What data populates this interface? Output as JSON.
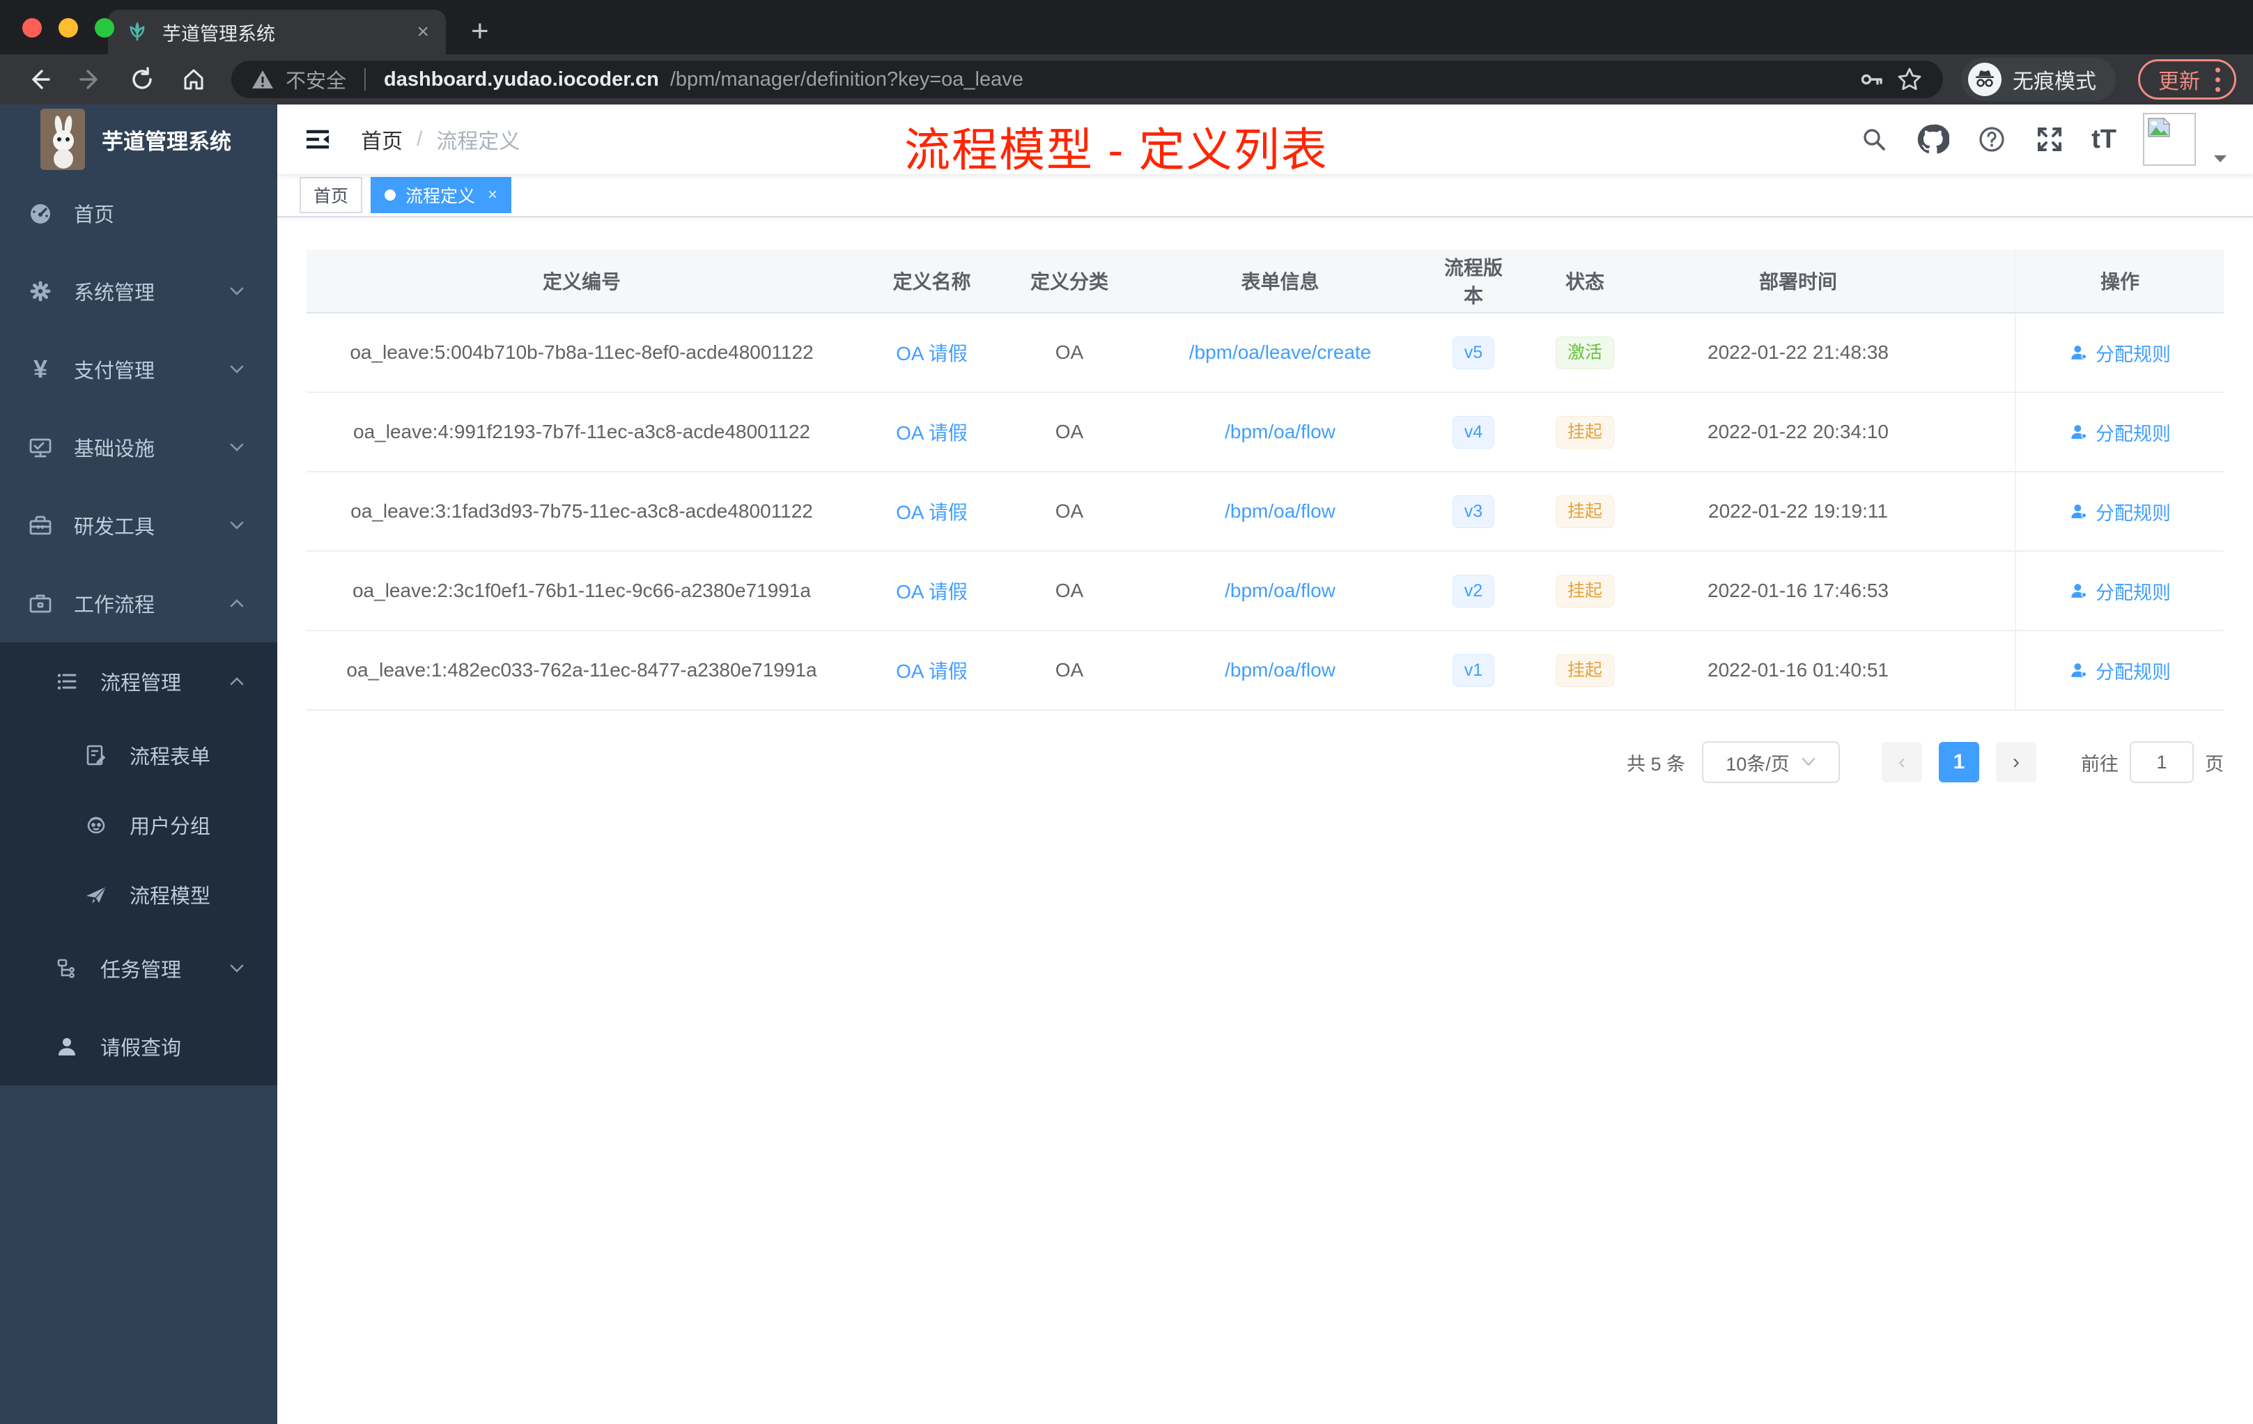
{
  "browser": {
    "tab_title": "芋道管理系统",
    "tab_close": "×",
    "new_tab": "+",
    "security_label": "不安全",
    "url_host": "dashboard.yudao.iocoder.cn",
    "url_path": "/bpm/manager/definition?key=oa_leave",
    "incognito_label": "无痕模式",
    "update_label": "更新"
  },
  "sidebar": {
    "app_title": "芋道管理系统",
    "items": [
      {
        "label": "首页"
      },
      {
        "label": "系统管理"
      },
      {
        "label": "支付管理"
      },
      {
        "label": "基础设施"
      },
      {
        "label": "研发工具"
      },
      {
        "label": "工作流程"
      },
      {
        "label": "流程管理"
      },
      {
        "label": "流程表单"
      },
      {
        "label": "用户分组"
      },
      {
        "label": "流程模型"
      },
      {
        "label": "任务管理"
      },
      {
        "label": "请假查询"
      }
    ]
  },
  "navbar": {
    "breadcrumb_home": "首页",
    "breadcrumb_sep": "/",
    "breadcrumb_current": "流程定义",
    "font_size_icon_text": "tT"
  },
  "annotation": {
    "text": "流程模型 - 定义列表",
    "color": "#ff2501"
  },
  "tags": [
    {
      "label": "首页",
      "active": false
    },
    {
      "label": "流程定义",
      "active": true,
      "close": "×"
    }
  ],
  "table": {
    "columns": [
      "定义编号",
      "定义名称",
      "定义分类",
      "表单信息",
      "流程版本",
      "状态",
      "部署时间",
      "操作"
    ],
    "rows": [
      {
        "id": "oa_leave:5:004b710b-7b8a-11ec-8ef0-acde48001122",
        "name": "OA 请假",
        "category": "OA",
        "form": "/bpm/oa/leave/create",
        "version": "v5",
        "status": "激活",
        "status_type": "active",
        "deployed": "2022-01-22 21:48:38",
        "action": "分配规则"
      },
      {
        "id": "oa_leave:4:991f2193-7b7f-11ec-a3c8-acde48001122",
        "name": "OA 请假",
        "category": "OA",
        "form": "/bpm/oa/flow",
        "version": "v4",
        "status": "挂起",
        "status_type": "suspended",
        "deployed": "2022-01-22 20:34:10",
        "action": "分配规则"
      },
      {
        "id": "oa_leave:3:1fad3d93-7b75-11ec-a3c8-acde48001122",
        "name": "OA 请假",
        "category": "OA",
        "form": "/bpm/oa/flow",
        "version": "v3",
        "status": "挂起",
        "status_type": "suspended",
        "deployed": "2022-01-22 19:19:11",
        "action": "分配规则"
      },
      {
        "id": "oa_leave:2:3c1f0ef1-76b1-11ec-9c66-a2380e71991a",
        "name": "OA 请假",
        "category": "OA",
        "form": "/bpm/oa/flow",
        "version": "v2",
        "status": "挂起",
        "status_type": "suspended",
        "deployed": "2022-01-16 17:46:53",
        "action": "分配规则"
      },
      {
        "id": "oa_leave:1:482ec033-762a-11ec-8477-a2380e71991a",
        "name": "OA 请假",
        "category": "OA",
        "form": "/bpm/oa/flow",
        "version": "v1",
        "status": "挂起",
        "status_type": "suspended",
        "deployed": "2022-01-16 01:40:51",
        "action": "分配规则"
      }
    ]
  },
  "pagination": {
    "total_label": "共 5 条",
    "page_size": "10条/页",
    "prev": "‹",
    "current_page": "1",
    "next": "›",
    "goto_label": "前往",
    "goto_value": "1",
    "page_unit": "页"
  },
  "colors": {
    "accent": "#409eff",
    "sidebar_bg": "#304156",
    "submenu_bg": "#1f2d3d",
    "status_active": "#67c23a",
    "status_suspended": "#e6a23c",
    "annotation_red": "#ff2501"
  }
}
